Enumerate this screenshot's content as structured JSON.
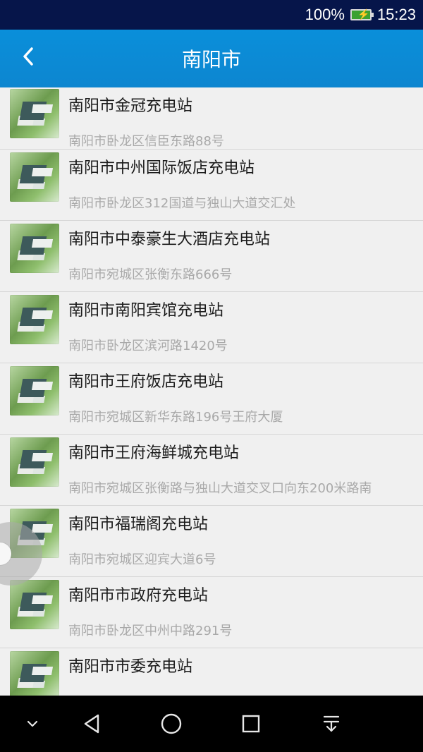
{
  "status_bar": {
    "battery": "100%",
    "time": "15:23",
    "colors": {
      "background": "#06154a",
      "battery_fill": "#3ca132"
    }
  },
  "header": {
    "title": "南阳市",
    "back_icon": "chevron-left-icon",
    "colors": {
      "background": "#0a8fda"
    }
  },
  "stations": [
    {
      "name": "南阳市金冠充电站",
      "address": "南阳市卧龙区信臣东路88号"
    },
    {
      "name": "南阳市中州国际饭店充电站",
      "address": "南阳市卧龙区312国道与独山大道交汇处"
    },
    {
      "name": "南阳市中泰豪生大酒店充电站",
      "address": "南阳市宛城区张衡东路666号"
    },
    {
      "name": "南阳市南阳宾馆充电站",
      "address": "南阳市卧龙区滨河路1420号"
    },
    {
      "name": "南阳市王府饭店充电站",
      "address": "南阳市宛城区新华东路196号王府大厦"
    },
    {
      "name": "南阳市王府海鲜城充电站",
      "address": "南阳市宛城区张衡路与独山大道交叉口向东200米路南"
    },
    {
      "name": "南阳市福瑞阁充电站",
      "address": "南阳市宛城区迎宾大道6号"
    },
    {
      "name": "南阳市市政府充电站",
      "address": "南阳市卧龙区中州中路291号"
    },
    {
      "name": "南阳市市委充电站",
      "address": ""
    }
  ],
  "navigation_bar": {
    "buttons": [
      {
        "icon": "chevron-down-icon"
      },
      {
        "icon": "back-triangle-icon"
      },
      {
        "icon": "home-circle-icon"
      },
      {
        "icon": "recents-square-icon"
      },
      {
        "icon": "notifications-down-icon"
      }
    ],
    "colors": {
      "background": "#000000"
    }
  }
}
